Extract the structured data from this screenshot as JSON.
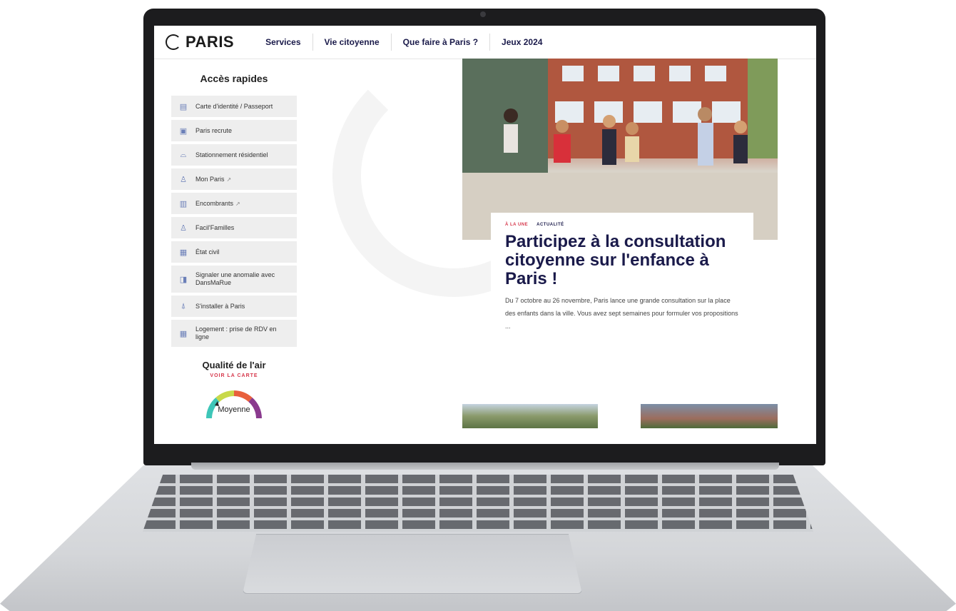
{
  "site": {
    "logo_text": "PARIS",
    "nav": [
      "Services",
      "Vie citoyenne",
      "Que faire à Paris ?",
      "Jeux 2024"
    ]
  },
  "sidebar": {
    "title": "Accès rapides",
    "items": [
      {
        "label": "Carte d'identité / Passeport",
        "icon": "id-card-icon",
        "external": false
      },
      {
        "label": "Paris recrute",
        "icon": "briefcase-icon",
        "external": false
      },
      {
        "label": "Stationnement résidentiel",
        "icon": "car-icon",
        "external": false
      },
      {
        "label": "Mon Paris",
        "icon": "user-icon",
        "external": true
      },
      {
        "label": "Encombrants",
        "icon": "furniture-icon",
        "external": true
      },
      {
        "label": "Facil'Familles",
        "icon": "family-icon",
        "external": false
      },
      {
        "label": "État civil",
        "icon": "document-icon",
        "external": false
      },
      {
        "label": "Signaler une anomalie avec DansMaRue",
        "icon": "alert-icon",
        "external": false
      },
      {
        "label": "S'installer à Paris",
        "icon": "eiffel-tower-icon",
        "external": false
      },
      {
        "label": "Logement : prise de RDV en ligne",
        "icon": "building-icon",
        "external": false
      }
    ],
    "air_quality": {
      "title": "Qualité de l'air",
      "link": "VOIR LA CARTE",
      "level": "Moyenne"
    }
  },
  "hero": {
    "tag_une": "À LA UNE",
    "tag_category": "ACTUALITÉ",
    "title": "Participez à la consultation citoyenne sur l'enfance à Paris !",
    "text": "Du 7 octobre au 26 novembre, Paris lance une grande consultation sur la place des enfants dans la ville. Vous avez sept semaines pour formuler vos propositions ..."
  },
  "colors": {
    "brand_navy": "#1a1a4a",
    "accent_red": "#d6374b",
    "sidebar_bg": "#eeeeee"
  }
}
